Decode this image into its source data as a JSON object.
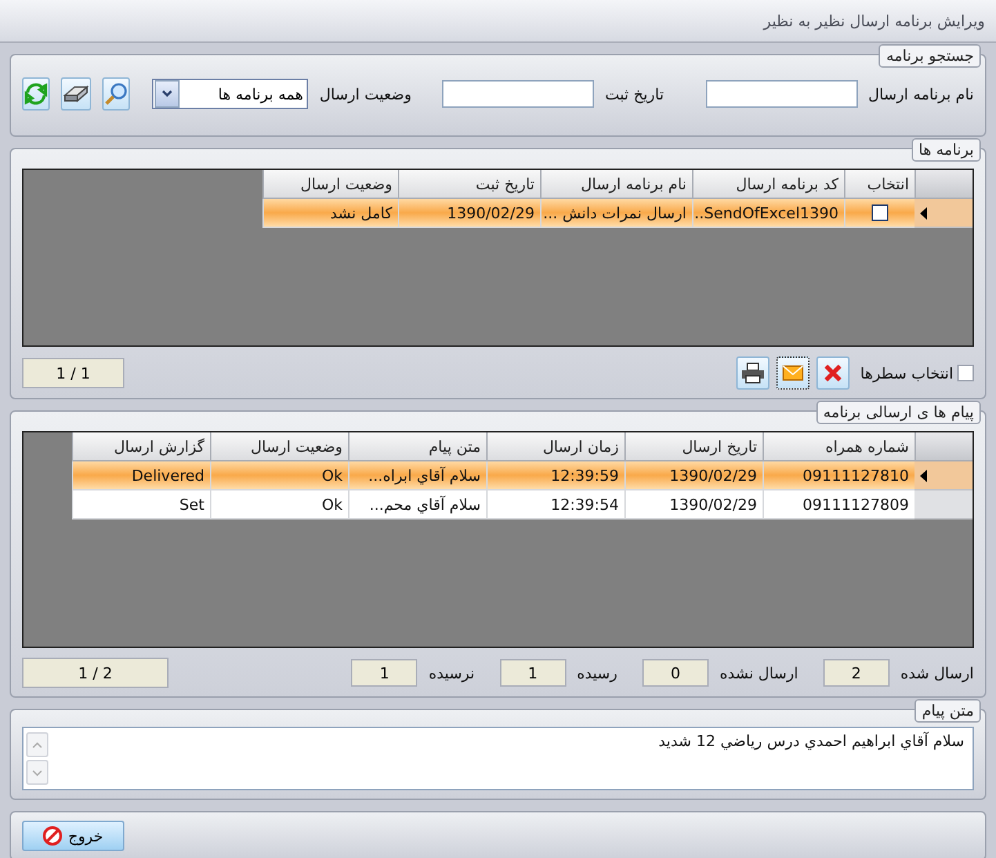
{
  "window": {
    "title": "ویرایش برنامه ارسال نظیر به نظیر"
  },
  "search": {
    "title": "جستجو برنامه",
    "fields": [
      {
        "label": "نام برنامه ارسال"
      },
      {
        "label": "تاریخ ثبت"
      }
    ],
    "status_label": "وضعیت ارسال",
    "status_value": "همه برنامه ها"
  },
  "programs": {
    "title": "برنامه ها",
    "columns": [
      "انتخاب",
      "کد برنامه ارسال",
      "نام برنامه ارسال",
      "تاریخ ثبت",
      "وضعیت ارسال"
    ],
    "rows": [
      {
        "selected": true,
        "cells": [
          {
            "kind": "checkbox",
            "checked": false
          },
          {
            "kind": "text",
            "text": "SendOfExcel1390..."
          },
          {
            "kind": "text",
            "text": "ارسال نمرات دانش ..."
          },
          {
            "kind": "text",
            "text": "1390/02/29"
          },
          {
            "kind": "text",
            "text": "کامل نشد"
          }
        ]
      }
    ],
    "select_rows": {
      "label": "انتخاب سطرها",
      "checked": false
    },
    "pager": "1 / 1"
  },
  "messages": {
    "title": "پیام ها ی ارسالی برنامه",
    "columns": [
      "شماره همراه",
      "تاریخ ارسال",
      "زمان ارسال",
      "متن پیام",
      "وضعیت ارسال",
      "گزارش ارسال"
    ],
    "rows": [
      {
        "selected": true,
        "cells": [
          "09111127810",
          "1390/02/29",
          "12:39:59",
          "سلام آقاي ابراه...",
          "Ok",
          "Delivered"
        ]
      },
      {
        "selected": false,
        "cells": [
          "09111127809",
          "1390/02/29",
          "12:39:54",
          "سلام آقاي محم...",
          "Ok",
          "Set"
        ]
      }
    ],
    "counters": [
      {
        "label": "ارسال شده",
        "value": "2"
      },
      {
        "label": "ارسال نشده",
        "value": "0"
      },
      {
        "label": "رسیده",
        "value": "1"
      },
      {
        "label": "نرسیده",
        "value": "1"
      }
    ],
    "pager": "1 / 2"
  },
  "message_text": {
    "title": "متن پیام",
    "value": "سلام آقاي ابراهيم احمدي درس رياضي 12 شديد"
  },
  "exit_button": "خروج"
}
